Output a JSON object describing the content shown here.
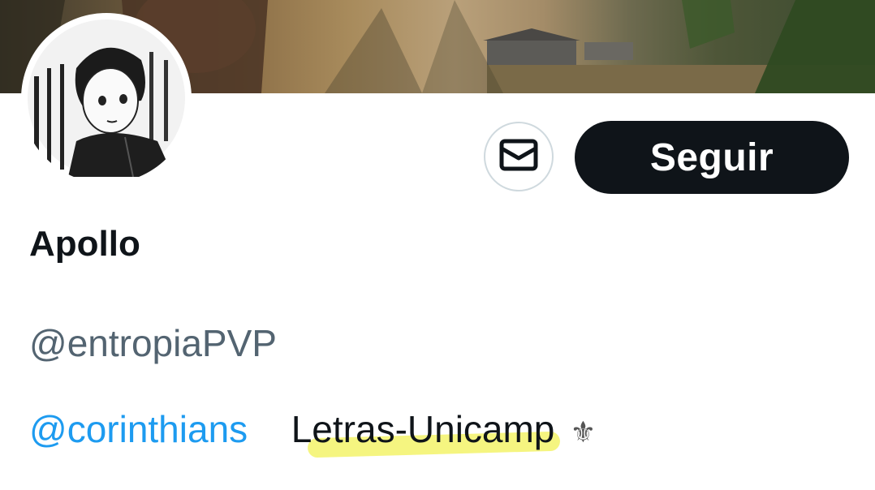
{
  "profile": {
    "display_name": "Apollo",
    "handle": "@entropiaPVP",
    "bio": {
      "mention": "@corinthians",
      "text": "Letras-Unicamp",
      "emoji": "⚜"
    }
  },
  "actions": {
    "follow_label": "Seguir",
    "message_icon": "envelope-icon"
  },
  "colors": {
    "follow_bg": "#0f1419",
    "mention": "#1d9bf0",
    "handle": "#536471",
    "highlight": "#f3f36a"
  }
}
